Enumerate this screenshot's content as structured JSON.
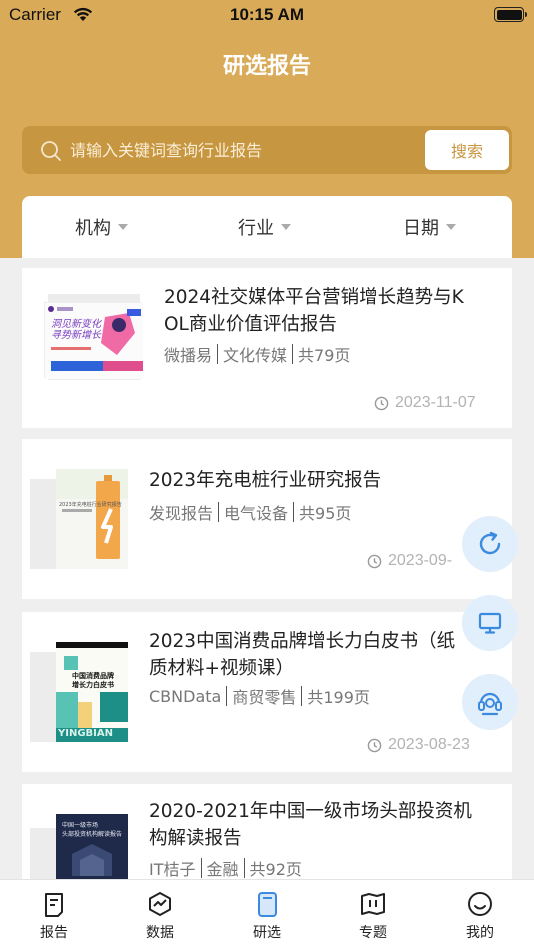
{
  "status_bar": {
    "carrier": "Carrier",
    "time": "10:15 AM"
  },
  "header": {
    "title": "研选报告"
  },
  "search": {
    "placeholder": "请输入关键词查询行业报告",
    "button_label": "搜索"
  },
  "filters": [
    {
      "label": "机构"
    },
    {
      "label": "行业"
    },
    {
      "label": "日期"
    }
  ],
  "reports": [
    {
      "title_line1": "2024社交媒体平台营销增长趋势与K",
      "title_line2": "OL商业价值评估报告",
      "source": "微播易",
      "industry": "文化传媒",
      "pages": "共79页",
      "date": "2023-11-07",
      "thumb_text": [
        "洞见新变化",
        "寻势新增长"
      ]
    },
    {
      "title_line1": "2023年充电桩行业研究报告",
      "title_line2": "",
      "source": "发现报告",
      "industry": "电气设备",
      "pages": "共95页",
      "date": "2023-09-",
      "thumb_text": [
        "2023年充电桩行业研究报告"
      ]
    },
    {
      "title_line1": "2023中国消费品牌增长力白皮书（纸",
      "title_line2": "质材料+视频课）",
      "source": "CBNData",
      "industry": "商贸零售",
      "pages": "共199页",
      "date": "2023-08-23",
      "thumb_text": [
        "中国消费品牌",
        "增长力白皮书",
        "YINGBIAN"
      ]
    },
    {
      "title_line1": "2020-2021年中国一级市场头部投资机",
      "title_line2": "构解读报告",
      "source": "IT桔子",
      "industry": "金融",
      "pages": "共92页",
      "date": "",
      "thumb_text": [
        "中国一级市场",
        "头部投资机构解读报告"
      ]
    }
  ],
  "tabbar": [
    {
      "label": "报告",
      "icon": "document-icon"
    },
    {
      "label": "数据",
      "icon": "chart-icon"
    },
    {
      "label": "研选",
      "icon": "book-icon",
      "active": true
    },
    {
      "label": "专题",
      "icon": "map-icon"
    },
    {
      "label": "我的",
      "icon": "smile-icon"
    }
  ],
  "colors": {
    "header": "#d9aa57",
    "search_bg": "#c79640",
    "fab_bg": "#e1eefb",
    "fab_icon": "#3a8be0",
    "active_tab": "#3a8be0"
  }
}
